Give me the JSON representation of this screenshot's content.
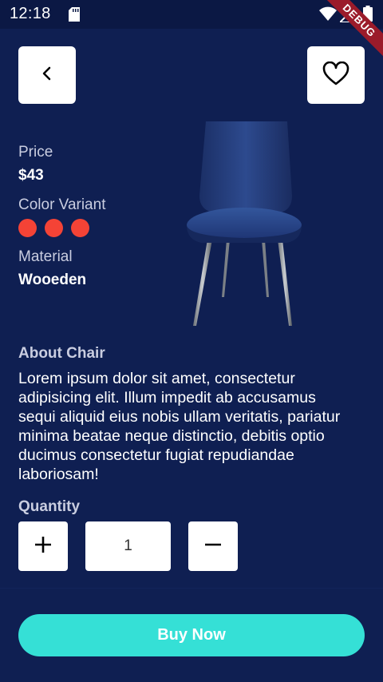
{
  "status_bar": {
    "time": "12:18",
    "debug_label": "DEBUG",
    "icons": [
      "sd-card-icon",
      "wifi-icon",
      "signal-icon",
      "battery-icon"
    ]
  },
  "header": {
    "back_icon": "chevron-left-icon",
    "favorite_icon": "heart-outline-icon"
  },
  "product": {
    "price_label": "Price",
    "price_value": "$43",
    "color_label": "Color Variant",
    "colors": [
      "#f44336",
      "#f44336",
      "#f44336"
    ],
    "material_label": "Material",
    "material_value": "Wooeden"
  },
  "about": {
    "title": "About Chair",
    "text": "Lorem ipsum dolor sit amet, consectetur adipisicing elit. Illum impedit ab accusamus sequi aliquid eius nobis ullam veritatis, pariatur minima beatae neque distinctio, debitis optio ducimus consectetur fugiat repudiandae laboriosam!"
  },
  "quantity": {
    "title": "Quantity",
    "value": "1",
    "increase_icon": "plus-icon",
    "decrease_icon": "minus-icon"
  },
  "buy_button": {
    "label": "Buy Now"
  },
  "colors": {
    "background": "#0f1f52",
    "status_bar": "#0b1844",
    "accent": "#35e0d6",
    "swatch": "#f44336"
  }
}
